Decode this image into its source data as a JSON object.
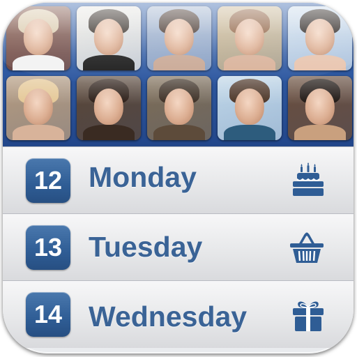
{
  "icon": {
    "accent_color": "#3a6396",
    "badge_color": "#2f5d95"
  },
  "photo_grid": {
    "rows": 2,
    "columns": 5,
    "photos": [
      {
        "name": "photo-child-sleeveless-top",
        "bg": "#7a4a3a",
        "hair": "#d8c7a8",
        "body": "#f2f2f2"
      },
      {
        "name": "photo-man-dark-shirt",
        "bg": "#e8e6e0",
        "hair": "#2c241d",
        "body": "#1b1b1b"
      },
      {
        "name": "photo-girl-open-mouth",
        "bg": "#9db0cc",
        "hair": "#3b2a22",
        "body": "#c9a895"
      },
      {
        "name": "photo-girl-smiling",
        "bg": "#c9b48d",
        "hair": "#8a5a3a",
        "body": "#d9b29a"
      },
      {
        "name": "photo-woman-profile",
        "bg": "#c7d9ea",
        "hair": "#1d1613",
        "body": "#e8c4ae"
      },
      {
        "name": "photo-blonde-woman",
        "bg": "#b49a7e",
        "hair": "#e4c795",
        "body": "#d8b39a"
      },
      {
        "name": "photo-dark-haired-woman",
        "bg": "#5a4636",
        "hair": "#2a1c15",
        "body": "#3a2b22"
      },
      {
        "name": "photo-man-smiling",
        "bg": "#7d6c55",
        "hair": "#3a2d22",
        "body": "#5d4b3a"
      },
      {
        "name": "photo-young-man",
        "bg": "#bfd6e7",
        "hair": "#4a3325",
        "body": "#2d5c7d"
      },
      {
        "name": "photo-woman-earrings",
        "bg": "#6a4e3c",
        "hair": "#1c1410",
        "body": "#c9a07e"
      }
    ]
  },
  "days": [
    {
      "number": "12",
      "label": "Monday",
      "icon": "birthday-cake-icon"
    },
    {
      "number": "13",
      "label": "Tuesday",
      "icon": "shopping-basket-icon"
    },
    {
      "number": "14",
      "label": "Wednesday",
      "icon": "gift-box-icon"
    }
  ]
}
